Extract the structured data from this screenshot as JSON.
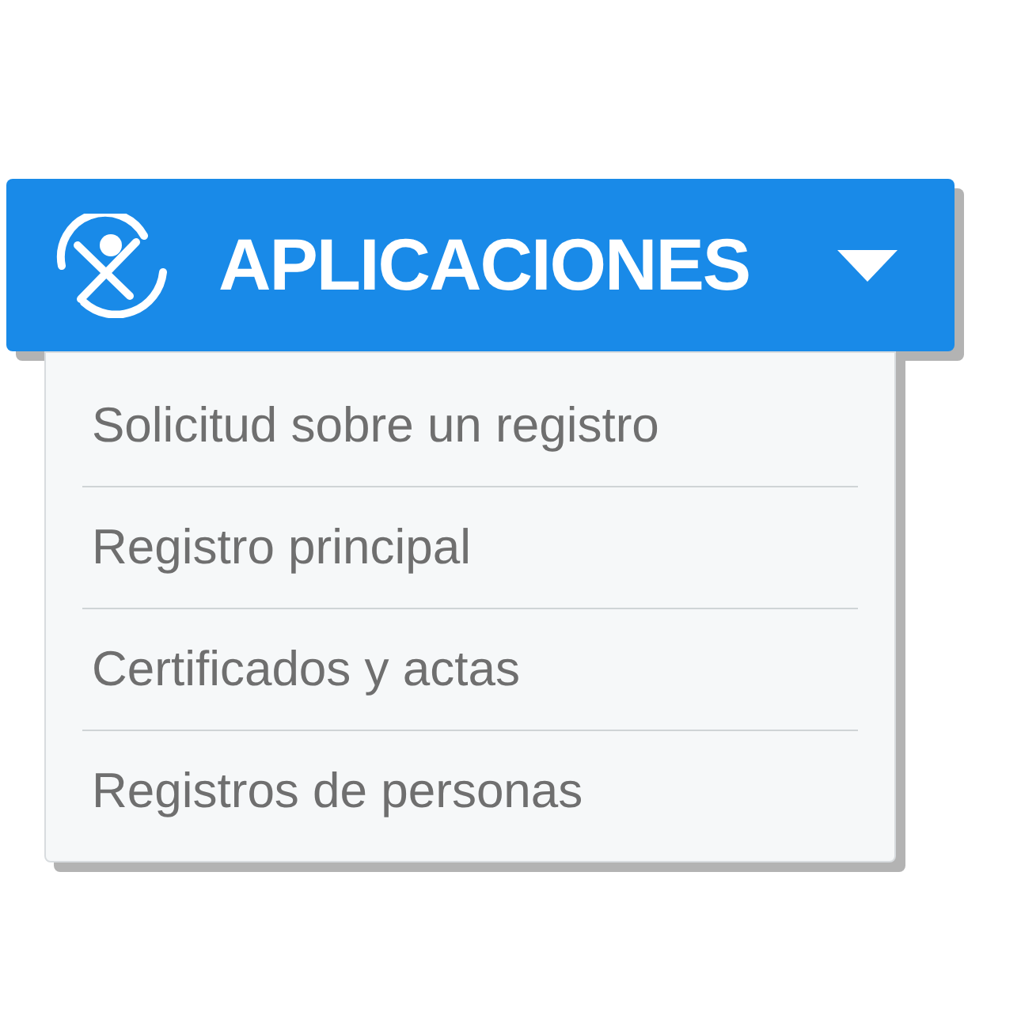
{
  "menu_button": {
    "label": "APLICACIONES",
    "expanded": true
  },
  "menu_items": [
    "Solicitud sobre un registro",
    "Registro principal",
    "Certificados y actas",
    "Registros de personas"
  ]
}
